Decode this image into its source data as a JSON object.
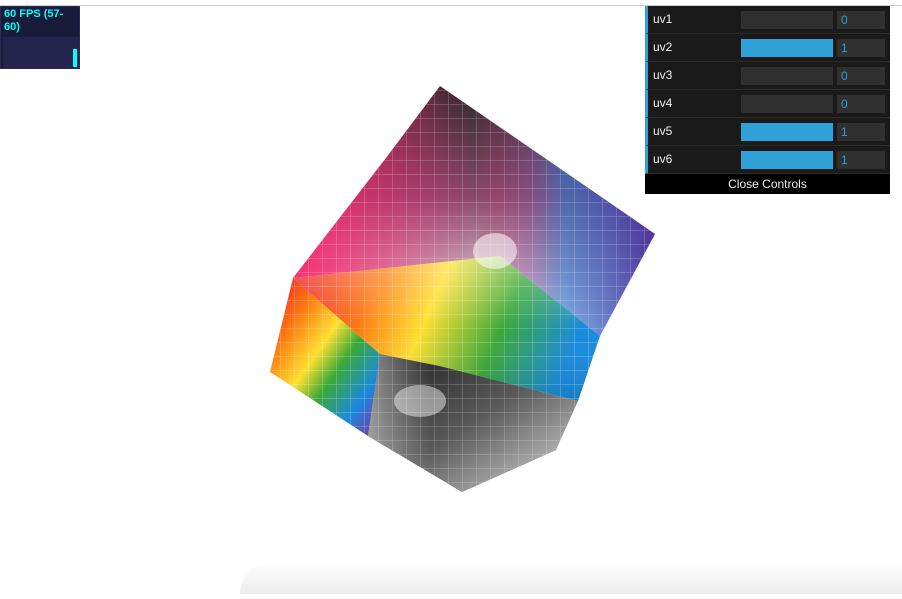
{
  "stats": {
    "text": "60 FPS (57-60)",
    "level": 0.95
  },
  "controls": {
    "rows": [
      {
        "label": "uv1",
        "value": "0",
        "fraction": 0
      },
      {
        "label": "uv2",
        "value": "1",
        "fraction": 1
      },
      {
        "label": "uv3",
        "value": "0",
        "fraction": 0
      },
      {
        "label": "uv4",
        "value": "0",
        "fraction": 0
      },
      {
        "label": "uv5",
        "value": "1",
        "fraction": 1
      },
      {
        "label": "uv6",
        "value": "1",
        "fraction": 1
      }
    ],
    "close_label": "Close Controls"
  },
  "colors": {
    "accent": "#2fa1d6",
    "stats_text": "#00ffff",
    "panel_bg": "#1a1a1a"
  }
}
